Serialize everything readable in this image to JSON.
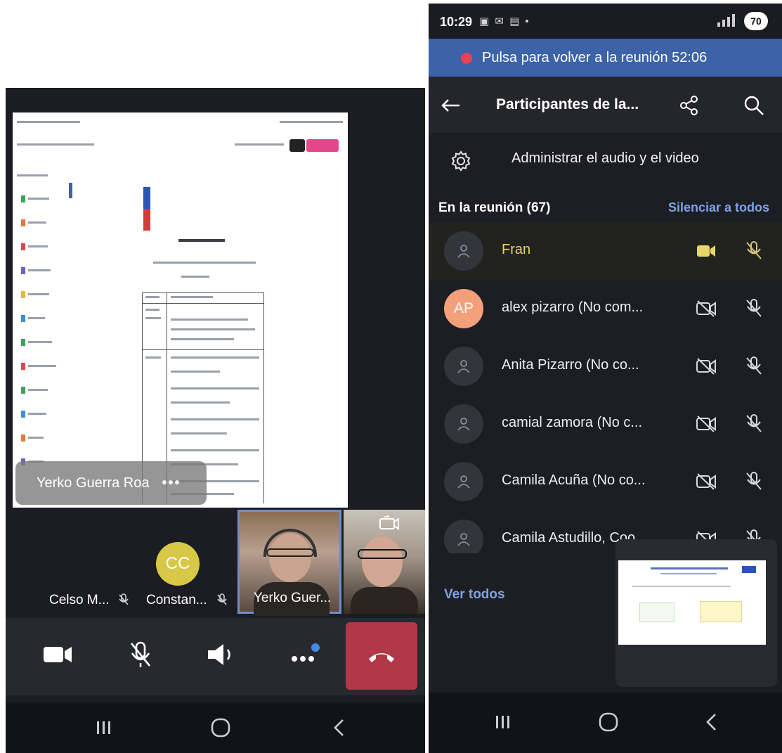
{
  "left_phone": {
    "presenter_name": "Yerko Guerra Roa",
    "presenter_more": "•••",
    "thumbnails": [
      {
        "name": "Celso M...",
        "muted": true
      },
      {
        "name": "Constan...",
        "initials": "CC",
        "muted": true
      },
      {
        "name": "Yerko Guer...",
        "video": true
      },
      {
        "name": "",
        "video": true
      }
    ],
    "controls": [
      "camera-icon",
      "mic-off-icon",
      "speaker-icon",
      "more-icon",
      "hangup-icon"
    ],
    "colors": {
      "hangup": "#b23747",
      "avatar_cc": "#d7c848"
    }
  },
  "right_phone": {
    "status": {
      "time": "10:29",
      "battery": "70"
    },
    "banner": {
      "text": "Pulsa para volver a la reunión 52:06"
    },
    "header": {
      "title": "Participantes de la..."
    },
    "manage": {
      "label": "Administrar el audio y el video"
    },
    "section": {
      "title": "En la reunión (67)",
      "mute_all": "Silenciar a todos"
    },
    "participants": [
      {
        "name": "Fran",
        "camera": "on",
        "mic": "off"
      },
      {
        "name": "alex pizarro (No com...",
        "initials": "AP",
        "camera": "off",
        "mic": "off"
      },
      {
        "name": "Anita Pizarro (No co...",
        "camera": "off",
        "mic": "off"
      },
      {
        "name": "camial zamora (No c...",
        "camera": "off",
        "mic": "off"
      },
      {
        "name": "Camila Acuña (No co...",
        "camera": "off",
        "mic": "off"
      },
      {
        "name": "Camila Astudillo, Coo...",
        "camera": "off",
        "mic": "off"
      }
    ],
    "view_all": "Ver todos",
    "colors": {
      "banner": "#3c62a8",
      "link": "#7ea3e6",
      "avatar_ap": "#f2a07a"
    }
  }
}
